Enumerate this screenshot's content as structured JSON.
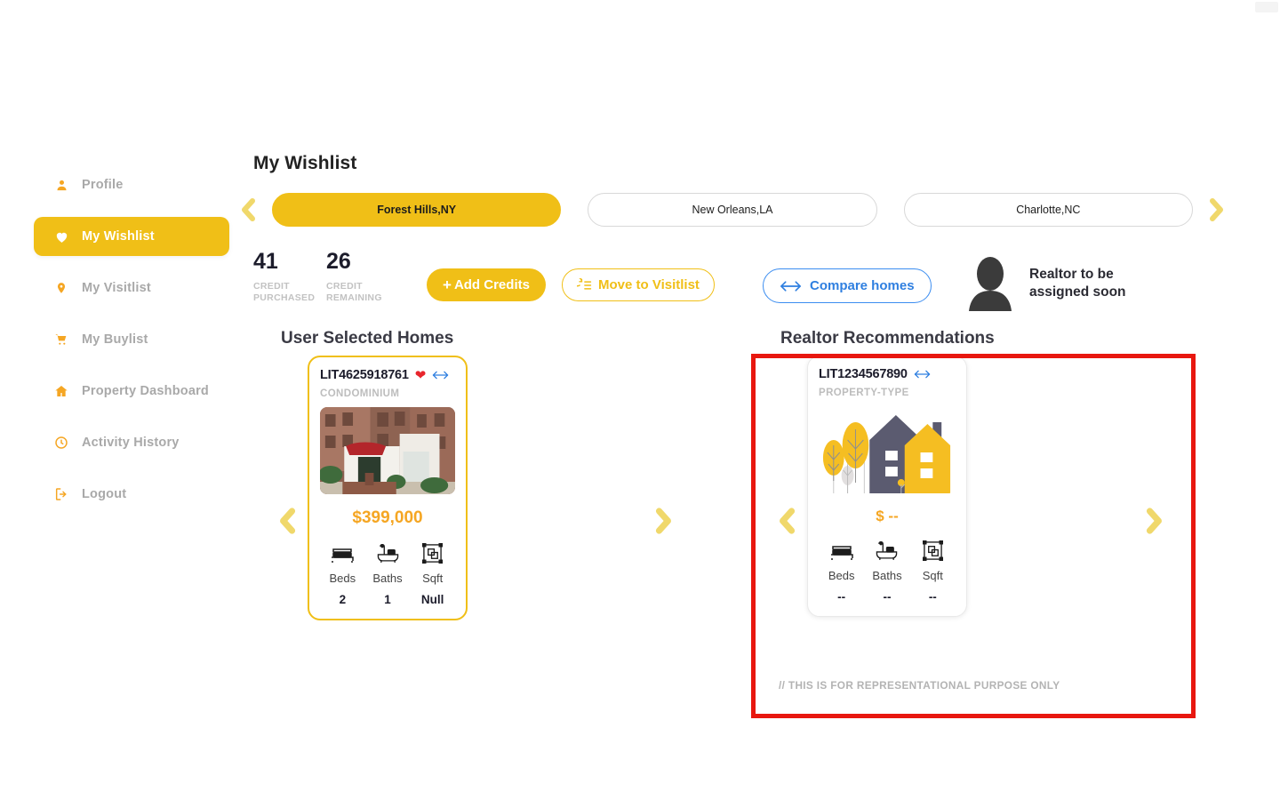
{
  "colors": {
    "brand_yellow": "#F0BF17",
    "price_orange": "#F5A623",
    "accent_blue": "#2F7FE0",
    "highlight_red": "#E8170F",
    "muted_grey": "#B3B3B3"
  },
  "sidebar": {
    "items": [
      {
        "label": "Profile",
        "icon": "user-icon",
        "active": false
      },
      {
        "label": "My Wishlist",
        "icon": "heart-icon",
        "active": true
      },
      {
        "label": "My Visitlist",
        "icon": "pin-icon",
        "active": false
      },
      {
        "label": "My Buylist",
        "icon": "cart-icon",
        "active": false
      },
      {
        "label": "Property Dashboard",
        "icon": "home-icon",
        "active": false
      },
      {
        "label": "Activity History",
        "icon": "clock-icon",
        "active": false
      },
      {
        "label": "Logout",
        "icon": "logout-icon",
        "active": false
      }
    ]
  },
  "header": {
    "title": "My Wishlist"
  },
  "city_tabs": {
    "prev_icon": "chevron-left-icon",
    "next_icon": "chevron-right-icon",
    "items": [
      {
        "label": "Forest Hills,NY",
        "active": true
      },
      {
        "label": "New Orleans,LA",
        "active": false
      },
      {
        "label": "Charlotte,NC",
        "active": false
      }
    ]
  },
  "credits": {
    "purchased_value": "41",
    "purchased_label": "CREDIT PURCHASED",
    "remaining_value": "26",
    "remaining_label": "CREDIT REMAINING",
    "add_credits_label": "Add Credits",
    "add_credits_icon": "plus-icon",
    "move_to_visitlist_label": "Move to Visitlist",
    "move_to_visitlist_icon": "move-list-icon"
  },
  "compare": {
    "label": "Compare homes",
    "icon": "compare-arrows-icon"
  },
  "realtor": {
    "avatar_icon": "avatar-icon",
    "line1": "Realtor to be",
    "line2": "assigned soon"
  },
  "user_selected": {
    "heading": "User Selected Homes",
    "prev_icon": "chevron-left-icon",
    "next_icon": "chevron-right-icon",
    "card": {
      "id": "LIT4625918761",
      "favorite_icon": "heart-filled-icon",
      "compare_icon": "compare-arrows-icon",
      "property_type": "CONDOMINIUM",
      "photo_icon": "building-photo",
      "price": "$399,000",
      "specs": [
        {
          "icon": "bed-icon",
          "label": "Beds",
          "value": "2"
        },
        {
          "icon": "bath-icon",
          "label": "Baths",
          "value": "1"
        },
        {
          "icon": "sqft-icon",
          "label": "Sqft",
          "value": "Null"
        }
      ]
    }
  },
  "realtor_recommendations": {
    "heading": "Realtor Recommendations",
    "prev_icon": "chevron-left-icon",
    "next_icon": "chevron-right-icon",
    "note": "// THIS IS FOR REPRESENTATIONAL PURPOSE ONLY",
    "card": {
      "id": "LIT1234567890",
      "compare_icon": "compare-arrows-icon",
      "property_type": "PROPERTY-TYPE",
      "photo_icon": "house-illustration",
      "price": "$ --",
      "specs": [
        {
          "icon": "bed-icon",
          "label": "Beds",
          "value": "--"
        },
        {
          "icon": "bath-icon",
          "label": "Baths",
          "value": "--"
        },
        {
          "icon": "sqft-icon",
          "label": "Sqft",
          "value": "--"
        }
      ]
    }
  }
}
